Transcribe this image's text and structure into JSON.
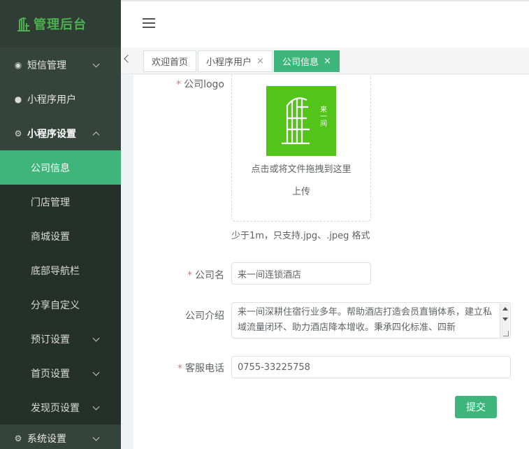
{
  "app": {
    "logo_text": "管理后台"
  },
  "sidebar": {
    "items": [
      {
        "label": "短信管理"
      },
      {
        "label": "小程序用户"
      },
      {
        "label": "小程序设置"
      },
      {
        "label": "公司信息"
      },
      {
        "label": "门店管理"
      },
      {
        "label": "商城设置"
      },
      {
        "label": "底部导航栏"
      },
      {
        "label": "分享自定义"
      },
      {
        "label": "预订设置"
      },
      {
        "label": "首页设置"
      },
      {
        "label": "发现页设置"
      },
      {
        "label": "系统设置"
      }
    ]
  },
  "tabs": [
    {
      "label": "欢迎首页"
    },
    {
      "label": "小程序用户",
      "close": "×"
    },
    {
      "label": "公司信息",
      "close": "×"
    }
  ],
  "form": {
    "logo_label": "公司logo",
    "upload_hint": "点击或将文件拖拽到这里",
    "upload_action": "上传",
    "upload_tip": "少于1m，只支持.jpg、.jpeg 格式",
    "logo_image_text": "来一间",
    "name_label": "公司名",
    "name_value": "来一间连锁酒店",
    "intro_label": "公司介绍",
    "intro_value": "来一间深耕住宿行业多年。帮助酒店打造会员直销体系，建立私域流量闭环、助力酒店降本增收。秉承四化标准、四新",
    "phone_label": "客服电话",
    "phone_value": "0755-33225758",
    "submit_label": "提交",
    "required_mark": "*"
  },
  "colors": {
    "accent": "#3db57b",
    "sidebar_bg": "#2c3a33",
    "logo_green": "#52c41a",
    "required": "#f56c6c"
  }
}
